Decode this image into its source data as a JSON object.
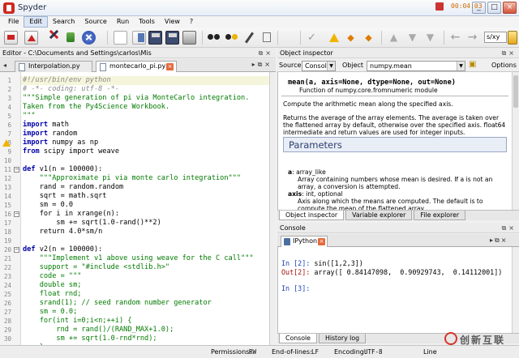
{
  "window": {
    "title": "Spyder",
    "controls": [
      "_",
      "□",
      "×"
    ]
  },
  "menubar": {
    "items": [
      "File",
      "Edit",
      "Search",
      "Source",
      "Run",
      "Tools",
      "View",
      "?"
    ],
    "active": "Edit"
  },
  "toolbar": {
    "combo_value": "s/xy",
    "icons": [
      "new-file-icon",
      "open-file-icon",
      "cut-icon",
      "run-icon",
      "stop-icon",
      "new-doc-icon",
      "copy-doc-icon",
      "save-icon",
      "save-all-icon",
      "print-icon",
      "find-icon",
      "find-replace-icon",
      "wand-icon",
      "tag-icon",
      "check-icon",
      "warning-icon",
      "up-arrow-icon",
      "down-arrow-icon",
      "back-icon",
      "forward-icon"
    ]
  },
  "editor": {
    "header": "Editor - C:\\Documents and Settings\\carlos\\Mis documentos\\Python\\montecarlo_pi.py",
    "tabs": [
      {
        "label": "Interpolation.py",
        "active": false
      },
      {
        "label": "montecarlo_pi.py",
        "active": true
      }
    ],
    "lines": [
      {
        "n": "1",
        "text": "#!/usr/bin/env python",
        "color": "#888888",
        "italic": true
      },
      {
        "n": "2",
        "text": "# -*- coding: utf-8 -*-",
        "color": "#888888",
        "italic": true
      },
      {
        "n": "3",
        "text": "\"\"\"Simple generation of pi via MonteCarlo integration.",
        "color": "#007a00"
      },
      {
        "n": "4",
        "text": "Taken from the Py4Science Workbook.",
        "color": "#007a00"
      },
      {
        "n": "5",
        "text": "\"\"\"",
        "color": "#007a00"
      },
      {
        "n": "6",
        "text": "import math",
        "kw": "import",
        "rest": " math"
      },
      {
        "n": "7",
        "text": "import random",
        "kw": "import",
        "rest": " random"
      },
      {
        "n": "8",
        "text": "import numpy as np",
        "kw": "import",
        "rest": " numpy as np",
        "warn": true
      },
      {
        "n": "9",
        "text": "from scipy import weave",
        "kw": "from",
        "rest": " scipy import weave"
      },
      {
        "n": "10",
        "text": ""
      },
      {
        "n": "11",
        "text": "def v1(n = 100000):",
        "kw": "def",
        "rest": " v1(n = 100000):",
        "fold": true
      },
      {
        "n": "12",
        "text": "    \"\"\"Approximate pi via monte carlo integration\"\"\"",
        "color": "#007a00"
      },
      {
        "n": "13",
        "text": "    rand = random.random"
      },
      {
        "n": "14",
        "text": "    sqrt = math.sqrt"
      },
      {
        "n": "15",
        "text": "    sm = 0.0"
      },
      {
        "n": "16",
        "text": "    for i in xrange(n):",
        "fold": true
      },
      {
        "n": "17",
        "text": "        sm += sqrt(1.0-rand()**2)"
      },
      {
        "n": "18",
        "text": "    return 4.0*sm/n"
      },
      {
        "n": "19",
        "text": ""
      },
      {
        "n": "20",
        "text": "def v2(n = 100000):",
        "kw": "def",
        "rest": " v2(n = 100000):",
        "fold": true
      },
      {
        "n": "21",
        "text": "    \"\"\"Implement v1 above using weave for the C call\"\"\"",
        "color": "#007a00"
      },
      {
        "n": "22",
        "text": "    support = \"#include <stdlib.h>\"",
        "color": "#007a00"
      },
      {
        "n": "23",
        "text": "    code = \"\"\"",
        "color": "#007a00"
      },
      {
        "n": "24",
        "text": "    double sm;",
        "color": "#007a00"
      },
      {
        "n": "25",
        "text": "    float rnd;",
        "color": "#007a00"
      },
      {
        "n": "26",
        "text": "    srand(1); // seed random number generator",
        "color": "#007a00"
      },
      {
        "n": "27",
        "text": "    sm = 0.0;",
        "color": "#007a00"
      },
      {
        "n": "28",
        "text": "    for(int i=0;i<n;++i) {",
        "color": "#007a00"
      },
      {
        "n": "29",
        "text": "        rnd = rand()/(RAND_MAX+1.0);",
        "color": "#007a00"
      },
      {
        "n": "30",
        "text": "        sm += sqrt(1.0-rnd*rnd);",
        "color": "#007a00"
      },
      {
        "n": "31",
        "text": "    }",
        "color": "#007a00"
      }
    ]
  },
  "object_inspector": {
    "header": "Object inspector",
    "source_label": "Source",
    "source_value": "Console",
    "object_label": "Object",
    "object_value": "numpy.mean",
    "options_label": "Options",
    "signature": "mean(a, axis=None, dtype=None, out=None)",
    "function_of": "Function of numpy.core.fromnumeric module",
    "summary": "Compute the arithmetic mean along the specified axis.",
    "description": "Returns the average of the array elements. The average is taken over the flattened array by default, otherwise over the specified axis. float64 intermediate and return values are used for integer inputs.",
    "params_title": "Parameters",
    "param1_name": "a",
    "param1_type": ": array_like",
    "param1_desc": "Array containing numbers whose mean is desired. If a is not an array, a conversion is attempted.",
    "param2_name": "axis",
    "param2_type": ": int, optional",
    "param2_desc": "Axis along which the means are computed. The default is to compute the mean of the flattened array.",
    "bottom_tabs": [
      "Object inspector",
      "Variable explorer",
      "File explorer"
    ]
  },
  "console": {
    "header": "Console",
    "tab_label": "IPython 1",
    "timer": "00:04:03",
    "in2": "In [2]:",
    "in2_code": " sin([1,2,3])",
    "out2": "Out[2]:",
    "out2_value": " array([ 0.84147098,  0.90929743,  0.14112001])",
    "in3": "In [3]:",
    "bottom_tabs": [
      "Console",
      "History log"
    ]
  },
  "statusbar": {
    "permissions_label": "Permissions:",
    "permissions_value": "RW",
    "eol_label": "End-of-lines:",
    "eol_value": "LF",
    "encoding_label": "Encoding:",
    "encoding_value": "UTF-8",
    "line_label": "Line"
  },
  "watermark": {
    "text": "创新互联"
  }
}
